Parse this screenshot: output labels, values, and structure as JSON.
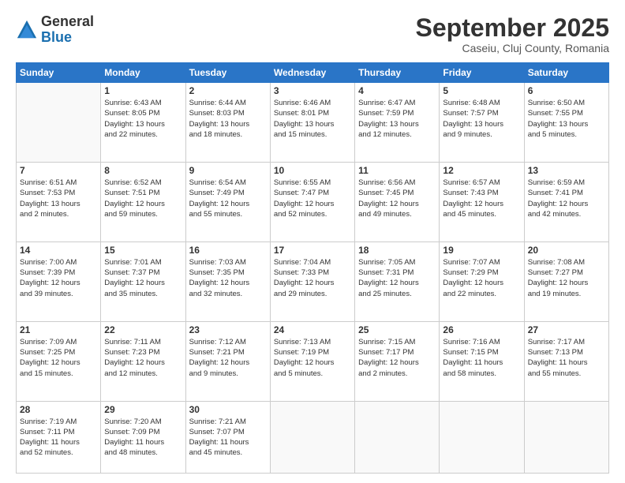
{
  "header": {
    "logo": {
      "general": "General",
      "blue": "Blue"
    },
    "title": "September 2025",
    "subtitle": "Caseiu, Cluj County, Romania"
  },
  "weekdays": [
    "Sunday",
    "Monday",
    "Tuesday",
    "Wednesday",
    "Thursday",
    "Friday",
    "Saturday"
  ],
  "weeks": [
    [
      {
        "day": "",
        "info": ""
      },
      {
        "day": "1",
        "info": "Sunrise: 6:43 AM\nSunset: 8:05 PM\nDaylight: 13 hours\nand 22 minutes."
      },
      {
        "day": "2",
        "info": "Sunrise: 6:44 AM\nSunset: 8:03 PM\nDaylight: 13 hours\nand 18 minutes."
      },
      {
        "day": "3",
        "info": "Sunrise: 6:46 AM\nSunset: 8:01 PM\nDaylight: 13 hours\nand 15 minutes."
      },
      {
        "day": "4",
        "info": "Sunrise: 6:47 AM\nSunset: 7:59 PM\nDaylight: 13 hours\nand 12 minutes."
      },
      {
        "day": "5",
        "info": "Sunrise: 6:48 AM\nSunset: 7:57 PM\nDaylight: 13 hours\nand 9 minutes."
      },
      {
        "day": "6",
        "info": "Sunrise: 6:50 AM\nSunset: 7:55 PM\nDaylight: 13 hours\nand 5 minutes."
      }
    ],
    [
      {
        "day": "7",
        "info": "Sunrise: 6:51 AM\nSunset: 7:53 PM\nDaylight: 13 hours\nand 2 minutes."
      },
      {
        "day": "8",
        "info": "Sunrise: 6:52 AM\nSunset: 7:51 PM\nDaylight: 12 hours\nand 59 minutes."
      },
      {
        "day": "9",
        "info": "Sunrise: 6:54 AM\nSunset: 7:49 PM\nDaylight: 12 hours\nand 55 minutes."
      },
      {
        "day": "10",
        "info": "Sunrise: 6:55 AM\nSunset: 7:47 PM\nDaylight: 12 hours\nand 52 minutes."
      },
      {
        "day": "11",
        "info": "Sunrise: 6:56 AM\nSunset: 7:45 PM\nDaylight: 12 hours\nand 49 minutes."
      },
      {
        "day": "12",
        "info": "Sunrise: 6:57 AM\nSunset: 7:43 PM\nDaylight: 12 hours\nand 45 minutes."
      },
      {
        "day": "13",
        "info": "Sunrise: 6:59 AM\nSunset: 7:41 PM\nDaylight: 12 hours\nand 42 minutes."
      }
    ],
    [
      {
        "day": "14",
        "info": "Sunrise: 7:00 AM\nSunset: 7:39 PM\nDaylight: 12 hours\nand 39 minutes."
      },
      {
        "day": "15",
        "info": "Sunrise: 7:01 AM\nSunset: 7:37 PM\nDaylight: 12 hours\nand 35 minutes."
      },
      {
        "day": "16",
        "info": "Sunrise: 7:03 AM\nSunset: 7:35 PM\nDaylight: 12 hours\nand 32 minutes."
      },
      {
        "day": "17",
        "info": "Sunrise: 7:04 AM\nSunset: 7:33 PM\nDaylight: 12 hours\nand 29 minutes."
      },
      {
        "day": "18",
        "info": "Sunrise: 7:05 AM\nSunset: 7:31 PM\nDaylight: 12 hours\nand 25 minutes."
      },
      {
        "day": "19",
        "info": "Sunrise: 7:07 AM\nSunset: 7:29 PM\nDaylight: 12 hours\nand 22 minutes."
      },
      {
        "day": "20",
        "info": "Sunrise: 7:08 AM\nSunset: 7:27 PM\nDaylight: 12 hours\nand 19 minutes."
      }
    ],
    [
      {
        "day": "21",
        "info": "Sunrise: 7:09 AM\nSunset: 7:25 PM\nDaylight: 12 hours\nand 15 minutes."
      },
      {
        "day": "22",
        "info": "Sunrise: 7:11 AM\nSunset: 7:23 PM\nDaylight: 12 hours\nand 12 minutes."
      },
      {
        "day": "23",
        "info": "Sunrise: 7:12 AM\nSunset: 7:21 PM\nDaylight: 12 hours\nand 9 minutes."
      },
      {
        "day": "24",
        "info": "Sunrise: 7:13 AM\nSunset: 7:19 PM\nDaylight: 12 hours\nand 5 minutes."
      },
      {
        "day": "25",
        "info": "Sunrise: 7:15 AM\nSunset: 7:17 PM\nDaylight: 12 hours\nand 2 minutes."
      },
      {
        "day": "26",
        "info": "Sunrise: 7:16 AM\nSunset: 7:15 PM\nDaylight: 11 hours\nand 58 minutes."
      },
      {
        "day": "27",
        "info": "Sunrise: 7:17 AM\nSunset: 7:13 PM\nDaylight: 11 hours\nand 55 minutes."
      }
    ],
    [
      {
        "day": "28",
        "info": "Sunrise: 7:19 AM\nSunset: 7:11 PM\nDaylight: 11 hours\nand 52 minutes."
      },
      {
        "day": "29",
        "info": "Sunrise: 7:20 AM\nSunset: 7:09 PM\nDaylight: 11 hours\nand 48 minutes."
      },
      {
        "day": "30",
        "info": "Sunrise: 7:21 AM\nSunset: 7:07 PM\nDaylight: 11 hours\nand 45 minutes."
      },
      {
        "day": "",
        "info": ""
      },
      {
        "day": "",
        "info": ""
      },
      {
        "day": "",
        "info": ""
      },
      {
        "day": "",
        "info": ""
      }
    ]
  ]
}
